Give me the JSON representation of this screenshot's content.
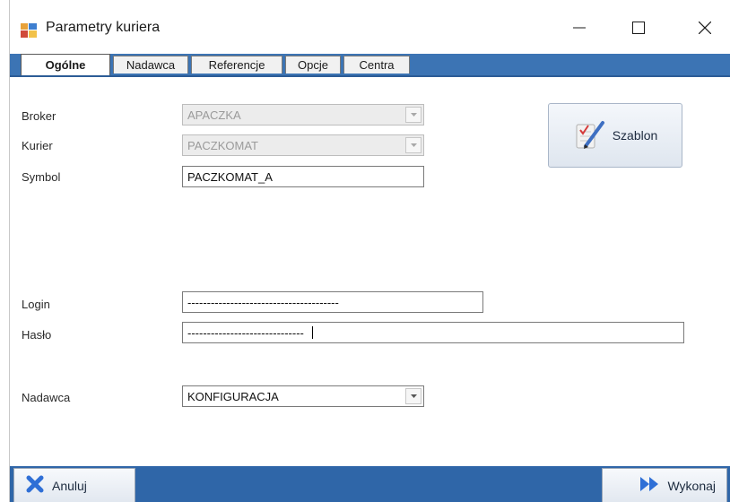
{
  "window": {
    "title": "Parametry kuriera",
    "app_icon": "app-window-icon",
    "controls": {
      "minimize": "minimize-icon",
      "maximize": "maximize-icon",
      "close": "close-icon"
    }
  },
  "tabs": [
    {
      "label": "Ogólne",
      "active": true
    },
    {
      "label": "Nadawca",
      "active": false
    },
    {
      "label": "Referencje",
      "active": false
    },
    {
      "label": "Opcje",
      "active": false
    },
    {
      "label": "Centra",
      "active": false
    }
  ],
  "form": {
    "broker": {
      "label": "Broker",
      "value": "APACZKA"
    },
    "kurier": {
      "label": "Kurier",
      "value": "PACZKOMAT"
    },
    "symbol": {
      "label": "Symbol",
      "value": "PACZKOMAT_A"
    },
    "login": {
      "label": "Login",
      "value": "---------------------------------------"
    },
    "haslo": {
      "label": "Hasło",
      "value": "------------------------------"
    },
    "nadawca": {
      "label": "Nadawca",
      "value": "KONFIGURACJA"
    }
  },
  "szablon": {
    "label": "Szablon",
    "icon": "template-icon"
  },
  "footer": {
    "cancel": {
      "label": "Anuluj",
      "icon": "x-icon"
    },
    "execute": {
      "label": "Wykonaj",
      "icon": "double-arrow-icon"
    }
  },
  "colors": {
    "tabstrip": "#3c74b4",
    "footer": "#2f66a8",
    "accent": "#2c5c96"
  }
}
